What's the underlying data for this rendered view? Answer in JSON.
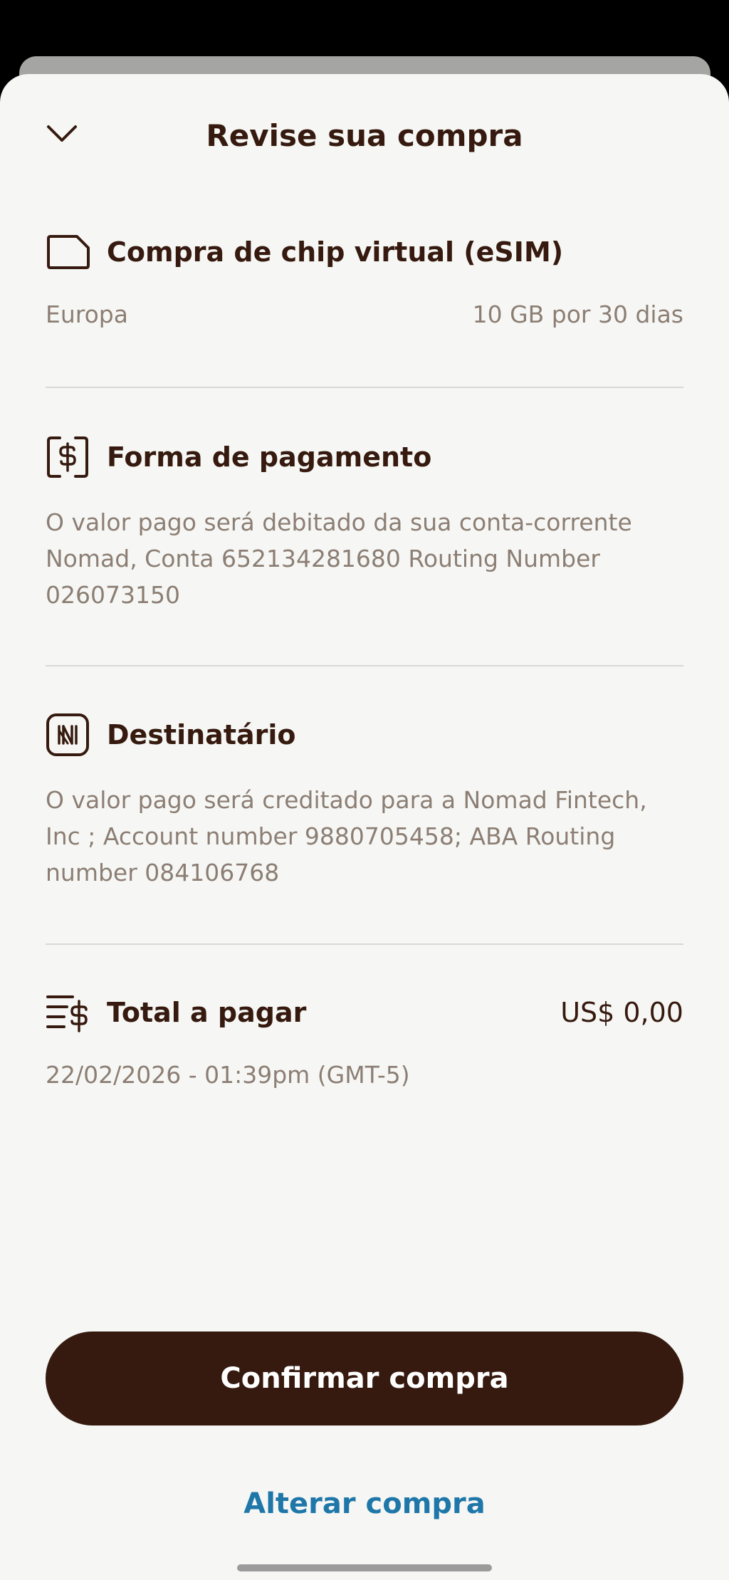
{
  "header": {
    "title": "Revise sua compra",
    "close_icon": "chevron-down-icon"
  },
  "esim": {
    "icon": "sim-card-icon",
    "title": "Compra de chip virtual (eSIM)",
    "region": "Europa",
    "plan": "10 GB por 30 dias"
  },
  "payment": {
    "icon": "dollar-bill-icon",
    "title": "Forma de pagamento",
    "description": "O valor pago será debitado da sua conta-corrente Nomad, Conta 652134281680 Routing Number 026073150"
  },
  "recipient": {
    "icon": "nomad-logo-icon",
    "title": "Destinatário",
    "description": "O valor pago será creditado para a Nomad Fintech, Inc ; Account number 9880705458; ABA Routing number 084106768"
  },
  "total": {
    "icon": "list-dollar-icon",
    "title": "Total a pagar",
    "amount": "US$ 0,00",
    "datetime": "22/02/2026 - 01:39pm (GMT-5)"
  },
  "actions": {
    "confirm_label": "Confirmar compra",
    "alter_label": "Alterar compra"
  },
  "colors": {
    "primary": "#361a0f",
    "link": "#1f77a9",
    "text_secondary": "#8c7e74",
    "background": "#f6f7f4"
  }
}
